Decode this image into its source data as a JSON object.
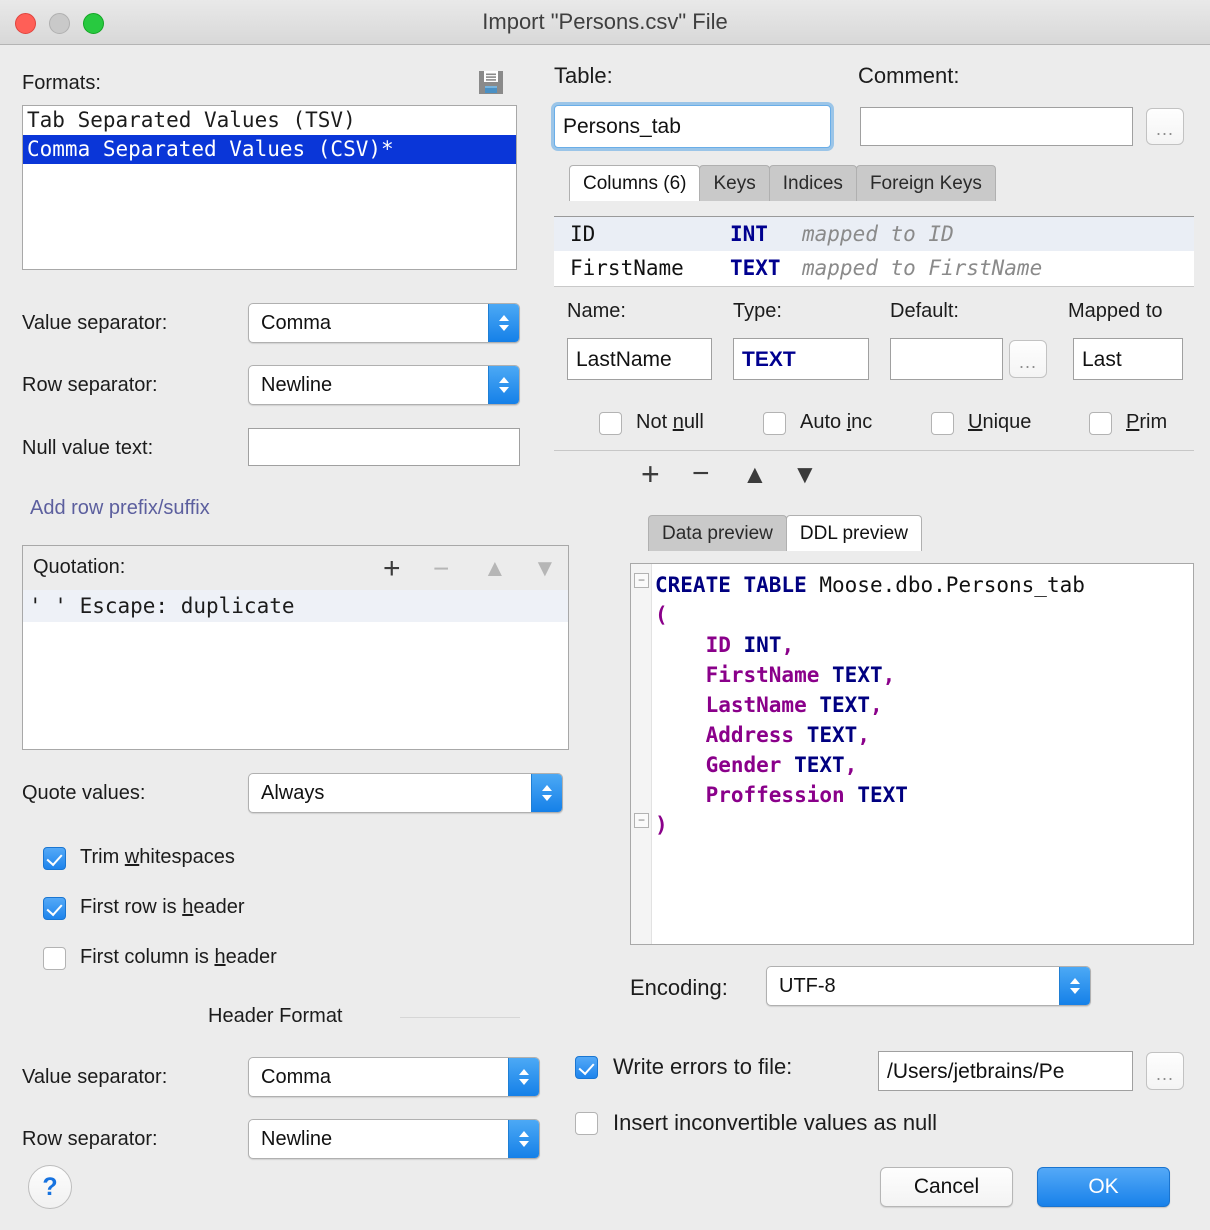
{
  "window": {
    "title": "Import \"Persons.csv\" File",
    "traffic_lights": [
      "close",
      "minimize",
      "maximize"
    ]
  },
  "left": {
    "formats_label": "Formats:",
    "save_format_icon": "save-icon",
    "formats": [
      {
        "label": "Tab Separated Values (TSV)",
        "selected": false
      },
      {
        "label": "Comma Separated Values (CSV)*",
        "selected": true
      }
    ],
    "value_separator_label": "Value separator:",
    "value_separator_value": "Comma",
    "row_separator_label": "Row separator:",
    "row_separator_value": "Newline",
    "null_value_label": "Null value text:",
    "null_value_value": "",
    "add_row_prefix_suffix": "Add row prefix/suffix",
    "quotation_label": "Quotation:",
    "quotation_toolbar": [
      "+",
      "−",
      "▲",
      "▼"
    ],
    "quotation_rows": [
      {
        "text": "'   '    Escape: duplicate"
      }
    ],
    "quote_values_label": "Quote values:",
    "quote_values_value": "Always",
    "checkboxes": [
      {
        "label": "Trim whitespaces",
        "mnemonic": "w",
        "checked": true
      },
      {
        "label": "First row is header",
        "mnemonic": "h",
        "checked": true
      },
      {
        "label": "First column is header",
        "mnemonic": "h",
        "checked": false
      }
    ],
    "header_format_title": "Header Format",
    "header_value_separator_label": "Value separator:",
    "header_value_separator_value": "Comma",
    "header_row_separator_label": "Row separator:",
    "header_row_separator_value": "Newline",
    "help_button": "?"
  },
  "right": {
    "table_label": "Table:",
    "table_value": "Persons_tab",
    "comment_label": "Comment:",
    "comment_value": "",
    "comment_browse": "...",
    "tabs": [
      {
        "label": "Columns (6)",
        "active": true
      },
      {
        "label": "Keys",
        "active": false
      },
      {
        "label": "Indices",
        "active": false
      },
      {
        "label": "Foreign Keys",
        "active": false
      }
    ],
    "columns": [
      {
        "name": "ID",
        "type": "INT",
        "mapped": "mapped to ID"
      },
      {
        "name": "FirstName",
        "type": "TEXT",
        "mapped": "mapped to FirstName"
      }
    ],
    "editor": {
      "name_label": "Name:",
      "name_value": "LastName",
      "type_label": "Type:",
      "type_value": "TEXT",
      "default_label": "Default:",
      "default_value": "",
      "default_browse": "...",
      "mapped_label": "Mapped to",
      "mapped_value": "Last",
      "flags": [
        {
          "label": "Not null",
          "mnemonic": "n",
          "checked": false
        },
        {
          "label": "Auto inc",
          "mnemonic": "i",
          "checked": false
        },
        {
          "label": "Unique",
          "mnemonic": "U",
          "checked": false
        },
        {
          "label": "Prim",
          "mnemonic": "P",
          "checked": false
        }
      ],
      "toolbar": [
        "+",
        "−",
        "▲",
        "▼"
      ]
    },
    "preview_tabs": [
      {
        "label": "Data preview",
        "active": false
      },
      {
        "label": "DDL preview",
        "active": true
      }
    ],
    "ddl": {
      "line1_kw": "CREATE TABLE",
      "line1_name": "Moose.dbo.Persons_tab",
      "open_paren": "(",
      "close_paren": ")",
      "columns": [
        {
          "name": "ID",
          "type": "INT",
          "comma": ","
        },
        {
          "name": "FirstName",
          "type": "TEXT",
          "comma": ","
        },
        {
          "name": "LastName",
          "type": "TEXT",
          "comma": ","
        },
        {
          "name": "Address",
          "type": "TEXT",
          "comma": ","
        },
        {
          "name": "Gender",
          "type": "TEXT",
          "comma": ","
        },
        {
          "name": "Proffession",
          "type": "TEXT",
          "comma": ""
        }
      ]
    },
    "encoding_label": "Encoding:",
    "encoding_value": "UTF-8",
    "write_errors_label": "Write errors to file:",
    "write_errors_checked": true,
    "write_errors_path": "/Users/jetbrains/Pe",
    "write_errors_browse": "...",
    "insert_inconvertible_label": "Insert inconvertible values as null",
    "insert_inconvertible_checked": false,
    "cancel_label": "Cancel",
    "ok_label": "OK"
  },
  "colors": {
    "accent": "#1881ea",
    "selection": "#0a36d8",
    "keyword": "#000080",
    "column": "#8a008a",
    "window_bg": "#ececec"
  }
}
